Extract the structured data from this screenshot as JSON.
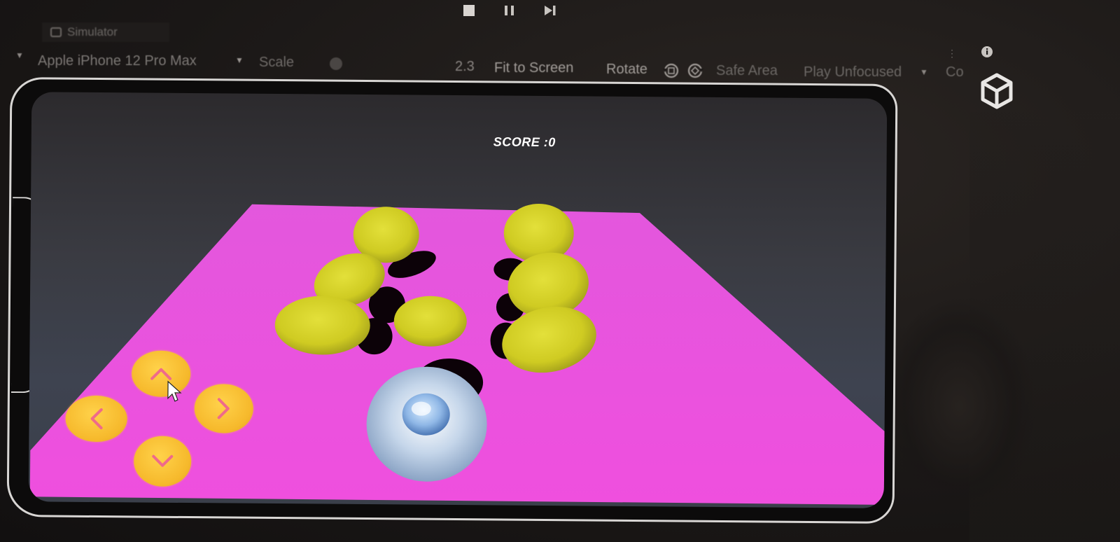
{
  "playback": {
    "stop_icon": "stop-icon",
    "pause_icon": "pause-icon",
    "step_icon": "step-icon"
  },
  "simulator_tab": {
    "label": "Simulator"
  },
  "toolbar": {
    "device": "Apple iPhone 12 Pro Max",
    "scale_label": "Scale",
    "scale_value": "2.3",
    "fit_label": "Fit to Screen",
    "rotate_label": "Rotate",
    "safe_area_label": "Safe Area",
    "play_mode": "Play Unfocused",
    "control_label": "Co"
  },
  "game": {
    "score_text": "SCORE :0",
    "colors": {
      "floor": "#ee4fe0",
      "coin": "#d9d528",
      "dpad": "#f6b92c",
      "arrow": "#ef6a8a",
      "ball": "#a9c9ea"
    }
  },
  "icons": {
    "menu": "kebab-icon",
    "info": "info-icon",
    "logo": "unity-logo-icon"
  }
}
